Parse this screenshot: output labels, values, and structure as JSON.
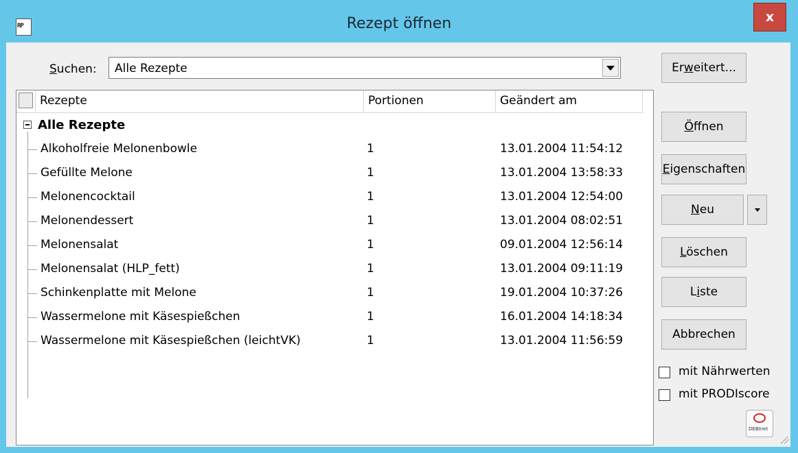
{
  "window": {
    "title": "Rezept öffnen",
    "icon_text": "RP",
    "close_label": "x"
  },
  "search": {
    "label_prefix": "S",
    "label_rest": "uchen:",
    "value": "Alle Rezepte"
  },
  "list": {
    "columns": [
      "Rezepte",
      "Portionen",
      "Geändert am"
    ],
    "group_label": "Alle Rezepte",
    "rows": [
      {
        "name": "Alkoholfreie Melonenbowle",
        "portions": "1",
        "changed": "13.01.2004 11:54:12"
      },
      {
        "name": "Gefüllte Melone",
        "portions": "1",
        "changed": "13.01.2004 13:58:33"
      },
      {
        "name": "Melonencocktail",
        "portions": "1",
        "changed": "13.01.2004 12:54:00"
      },
      {
        "name": "Melonendessert",
        "portions": "1",
        "changed": "13.01.2004 08:02:51"
      },
      {
        "name": "Melonensalat",
        "portions": "1",
        "changed": "09.01.2004 12:56:14"
      },
      {
        "name": "Melonensalat (HLP_fett)",
        "portions": "1",
        "changed": "13.01.2004 09:11:19"
      },
      {
        "name": "Schinkenplatte mit Melone",
        "portions": "1",
        "changed": "19.01.2004 10:37:26"
      },
      {
        "name": "Wassermelone mit Käsespießchen",
        "portions": "1",
        "changed": "16.01.2004 14:18:34"
      },
      {
        "name": "Wassermelone mit Käsespießchen (leichtVK)",
        "portions": "1",
        "changed": "13.01.2004 11:56:59"
      }
    ]
  },
  "buttons": {
    "erweitert": {
      "pre": "Er",
      "ul": "w",
      "post": "eitert..."
    },
    "oeffnen": {
      "pre": "",
      "ul": "Ö",
      "post": "ffnen"
    },
    "eigenschaften": {
      "pre": "",
      "ul": "E",
      "post": "igenschaften"
    },
    "neu": {
      "pre": "",
      "ul": "N",
      "post": "eu"
    },
    "loeschen": {
      "pre": "",
      "ul": "L",
      "post": "öschen"
    },
    "liste": {
      "pre": "L",
      "ul": "i",
      "post": "ste"
    },
    "abbrechen": "Abbrechen"
  },
  "checkboxes": {
    "naehrwerte": {
      "label": "mit Nährwerten",
      "checked": false
    },
    "prodiscore": {
      "label": "mit PRODIscore",
      "checked": false
    }
  },
  "logo": {
    "text": "DEBInet"
  },
  "colors": {
    "titlebar": "#64c7ea",
    "close": "#c9483f",
    "client": "#f0f0f0"
  }
}
